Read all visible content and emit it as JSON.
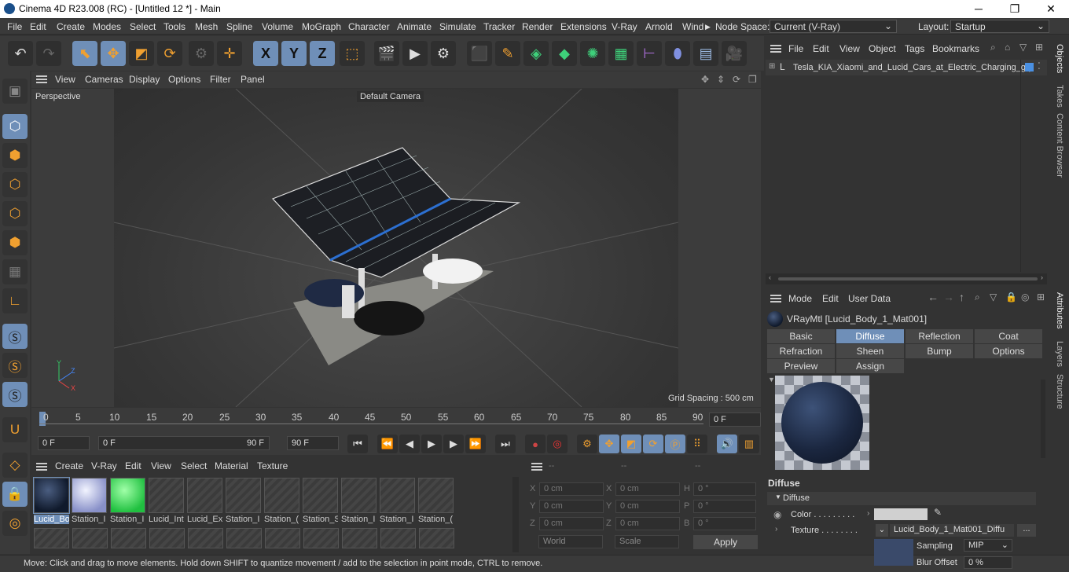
{
  "window": {
    "title": "Cinema 4D R23.008 (RC) - [Untitled 12 *] - Main",
    "min": "─",
    "max": "❐",
    "close": "✕"
  },
  "menu": [
    "File",
    "Edit",
    "Create",
    "Modes",
    "Select",
    "Tools",
    "Mesh",
    "Spline",
    "Volume",
    "MoGraph",
    "Character",
    "Animate",
    "Simulate",
    "Tracker",
    "Render",
    "Extensions",
    "V-Ray",
    "Arnold",
    "Wind"
  ],
  "node_space": {
    "label": "Node Space:",
    "value": "Current (V-Ray)"
  },
  "layout": {
    "label": "Layout:",
    "value": "Startup"
  },
  "toolbar": {
    "undo": "↶",
    "redo": "↷",
    "select": "⬉",
    "move": "✥",
    "scale": "◩",
    "rotate": "⟳",
    "x": "X",
    "y": "Y",
    "z": "Z",
    "coord": "⬚"
  },
  "viewport": {
    "menu": [
      "View",
      "Cameras",
      "Display",
      "Options",
      "Filter",
      "Panel"
    ],
    "name": "Perspective",
    "camera": "Default Camera",
    "grid": "Grid Spacing : 500 cm",
    "axis_y": "Y",
    "axis_z": "Z",
    "axis_x": "X"
  },
  "timeline": {
    "ticks": [
      "0",
      "5",
      "10",
      "15",
      "20",
      "25",
      "30",
      "35",
      "40",
      "45",
      "50",
      "55",
      "60",
      "65",
      "70",
      "75",
      "80",
      "85",
      "90"
    ],
    "current": "0 F"
  },
  "playback": {
    "start": "0 F",
    "range_start": "0 F",
    "range_end": "90 F",
    "end": "90 F"
  },
  "materials": {
    "menu": [
      "Create",
      "V-Ray",
      "Edit",
      "View",
      "Select",
      "Material",
      "Texture"
    ],
    "items": [
      "Lucid_Bo",
      "Station_I",
      "Station_I",
      "Lucid_Int",
      "Lucid_Ex",
      "Station_I",
      "Station_(",
      "Station_S",
      "Station_I",
      "Station_I",
      "Station_("
    ]
  },
  "coords": {
    "headers": [
      "--",
      "--",
      "--"
    ],
    "rows": [
      [
        "X",
        "0 cm",
        "X",
        "0 cm",
        "H",
        "0 °"
      ],
      [
        "Y",
        "0 cm",
        "Y",
        "0 cm",
        "P",
        "0 °"
      ],
      [
        "Z",
        "0 cm",
        "Z",
        "0 cm",
        "B",
        "0 °"
      ]
    ],
    "world": "World",
    "scale": "Scale",
    "apply": "Apply"
  },
  "status": "Move: Click and drag to move elements. Hold down SHIFT to quantize movement / add to the selection in point mode, CTRL to remove.",
  "objects": {
    "menu": [
      "File",
      "Edit",
      "View",
      "Object",
      "Tags",
      "Bookmarks"
    ],
    "item": "Tesla_KIA_Xiaomi_and_Lucid_Cars_at_Electric_Charging_grp"
  },
  "attributes": {
    "menu": [
      "Mode",
      "Edit",
      "User Data"
    ],
    "material": "VRayMtl [Lucid_Body_1_Mat001]",
    "tabs1": [
      "Basic",
      "Diffuse",
      "Reflection",
      "Coat"
    ],
    "tabs2": [
      "Refraction",
      "Sheen",
      "Bump",
      "Options"
    ],
    "tabs3": [
      "Preview Settings",
      "Assign"
    ],
    "section": "Diffuse",
    "group": "Diffuse",
    "color_label": "Color . . . . . . . . .",
    "texture_label": "Texture . . . . . . . .",
    "texture_value": "Lucid_Body_1_Mat001_Diffu",
    "sampling_label": "Sampling",
    "sampling_value": "MIP",
    "blur_label": "Blur Offset",
    "blur_value": "0 %",
    "more": "..."
  },
  "sidetabs": [
    "Objects",
    "Takes",
    "Content Browser",
    "Attributes",
    "Layers",
    "Structure"
  ]
}
